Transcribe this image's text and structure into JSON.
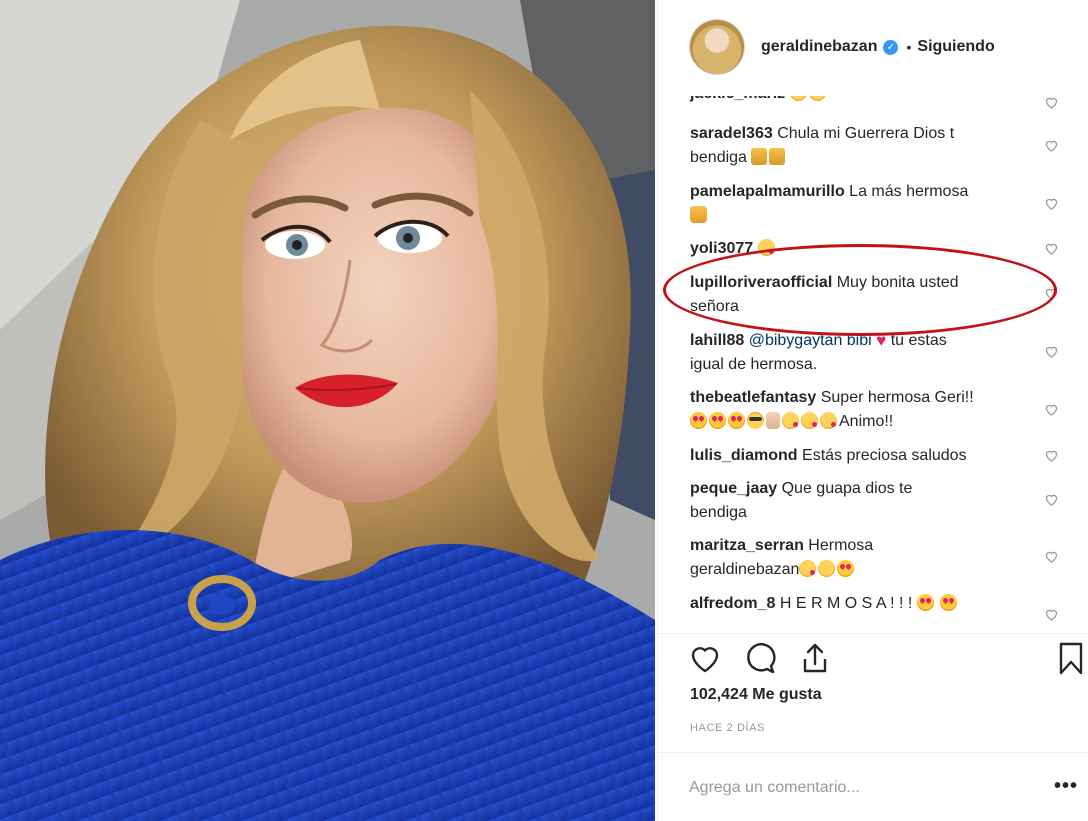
{
  "header": {
    "username": "geraldinebazan",
    "verified_icon": "verified-badge-icon",
    "separator": "•",
    "follow_status": "Siguiendo"
  },
  "comments": [
    {
      "user": "jackie_mariz",
      "text": "",
      "emoji": [
        "smile",
        "smile"
      ]
    },
    {
      "user": "saradel363",
      "text": "Chula mi Guerrera Dios t",
      "text2": "bendiga",
      "emoji": [
        "pray",
        "pray"
      ]
    },
    {
      "user": "pamelapalmamurillo",
      "text": "La más hermosa",
      "emoji": [
        "surprise"
      ]
    },
    {
      "user": "yoli3077",
      "text": "",
      "emoji": [
        "kiss"
      ]
    },
    {
      "user": "lupilloriveraofficial",
      "text": "Muy bonita usted",
      "text2": "señora"
    },
    {
      "user": "lahill88",
      "mention": "@bibygaytan bibi",
      "text": "tu estas",
      "text2": "igual de hermosa.",
      "emoji": [
        "red-heart"
      ]
    },
    {
      "user": "thebeatlefantasy",
      "text": "Super hermosa Geri!!",
      "text2": "Animo!!",
      "emoji": [
        "heart-eyes",
        "heart-eyes",
        "heart-eyes",
        "cool",
        "peace",
        "kiss",
        "kiss",
        "kiss"
      ]
    },
    {
      "user": "lulis_diamond",
      "text": "Estás preciosa saludos"
    },
    {
      "user": "peque_jaay",
      "text": "Que guapa dios te",
      "text2": "bendiga"
    },
    {
      "user": "maritza_serran",
      "text": "Hermosa",
      "text2": "geraldinebazan",
      "emoji": [
        "kiss",
        "smile",
        "heart-eyes"
      ]
    },
    {
      "user": "alfredom_8",
      "text": "H E R M O S A ! ! !",
      "emoji": [
        "heart-eyes",
        "heart-eyes"
      ]
    }
  ],
  "actions": {
    "like_icon": "heart-outline-icon",
    "comment_icon": "comment-bubble-icon",
    "share_icon": "share-upload-icon",
    "save_icon": "bookmark-icon"
  },
  "likes": "102,424 Me gusta",
  "timestamp": "HACE 2 DÍAS",
  "add_comment": {
    "placeholder": "Agrega un comentario...",
    "more": "•••"
  },
  "colors": {
    "highlight_ring": "#c4121b",
    "verified": "#3897f0",
    "sweater": "#1f46c4",
    "lipstick": "#d8202d"
  }
}
